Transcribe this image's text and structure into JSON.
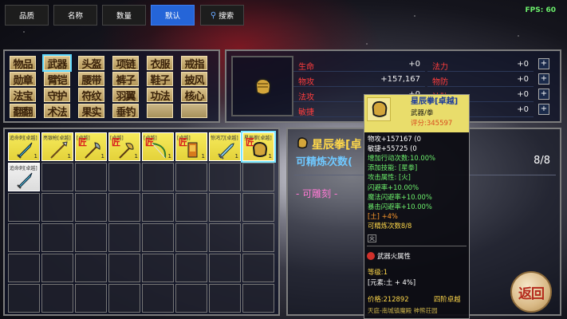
{
  "toolbar": {
    "quality_label": "品质",
    "name_label": "名称",
    "quantity_label": "数量",
    "default_label": "默认",
    "search_label": "搜索",
    "fps": "FPS: 60"
  },
  "categories": [
    "物品",
    "武器",
    "头盔",
    "项链",
    "衣服",
    "戒指",
    "勋章",
    "臂铠",
    "腰带",
    "裤子",
    "鞋子",
    "披风",
    "法宝",
    "守护",
    "符纹",
    "羽翼",
    "功法",
    "核心",
    "翻翻",
    "术法",
    "果实",
    "垂钓",
    "",
    ""
  ],
  "stats": {
    "left": [
      {
        "label": "生命",
        "value": "+0"
      },
      {
        "label": "物攻",
        "value": "+157,167"
      },
      {
        "label": "法攻",
        "value": "+0"
      },
      {
        "label": "敏捷",
        "value": "+55,725"
      }
    ],
    "right": [
      {
        "label": "法力",
        "value": "+0"
      },
      {
        "label": "物防",
        "value": "+0"
      },
      {
        "label": "法防",
        "value": "+0"
      },
      {
        "label": "闪避",
        "value": "+0"
      }
    ],
    "button_label": "+"
  },
  "inventory": [
    {
      "name": "追命刺[卓越]",
      "count": "1",
      "tag": "",
      "icon": "dagger-icon"
    },
    {
      "name": "亮银枪[卓越]",
      "count": "1",
      "tag": "",
      "icon": "spear-icon"
    },
    {
      "name": "[卓越]",
      "count": "1",
      "tag": "匠",
      "icon": "polearm-icon"
    },
    {
      "name": "[卓越]",
      "count": "1",
      "tag": "匠",
      "icon": "axe-icon"
    },
    {
      "name": "[卓越]",
      "count": "1",
      "tag": "匠",
      "icon": "bow-icon"
    },
    {
      "name": "[卓越]",
      "count": "1",
      "tag": "匠",
      "icon": "book-icon"
    },
    {
      "name": "惊鸿刀[卓越]",
      "count": "1",
      "tag": "",
      "icon": "sword-icon"
    },
    {
      "name": "星辰拳[卓越]",
      "count": "1",
      "tag": "匠",
      "icon": "fist-icon"
    },
    {
      "name": "追命刺[卓越]",
      "count": "",
      "tag": "",
      "icon": "dagger-icon"
    }
  ],
  "detail": {
    "title": "星辰拳[卓",
    "refine_label": "可精炼次数(",
    "refine_count": "8/8",
    "engrave_label": "- 可雕刻 -"
  },
  "tooltip": {
    "title": "星辰拳[卓越]",
    "type": "武器/拳",
    "score": "评分:345597",
    "lines": [
      {
        "text": "物攻+157167 (0",
        "color": "#ffffff"
      },
      {
        "text": "敏捷+55725 (0",
        "color": "#ffffff"
      },
      {
        "text": "增加行动次数:10.00%",
        "color": "#6cf06c"
      },
      {
        "text": "添加技能: [星拳]",
        "color": "#6cf06c"
      },
      {
        "text": "攻击属性: [火]",
        "color": "#6cf06c"
      },
      {
        "text": "闪避率+10.00%",
        "color": "#6cf06c"
      },
      {
        "text": "魔法闪避率+10.00%",
        "color": "#6cf06c"
      },
      {
        "text": "暴击闪避率+10.00%",
        "color": "#6cf06c"
      },
      {
        "text": "[土] +4%",
        "color": "#ff9a2c"
      },
      {
        "text": "可精炼次数8/8",
        "color": "#ffd84a"
      }
    ],
    "fire_attr": "武器火属性",
    "level": "等级:1",
    "element": "[元素:土 + 4%]",
    "price": "价格:212892",
    "tier": "四阶卓越",
    "origin": "天庭-南城镇魔殿 神熊荘园"
  },
  "back_label": "返回",
  "colors": {
    "accent": "#2565d8",
    "stat_label": "#ff3d3d",
    "item_bg": "#f6ea5c"
  }
}
